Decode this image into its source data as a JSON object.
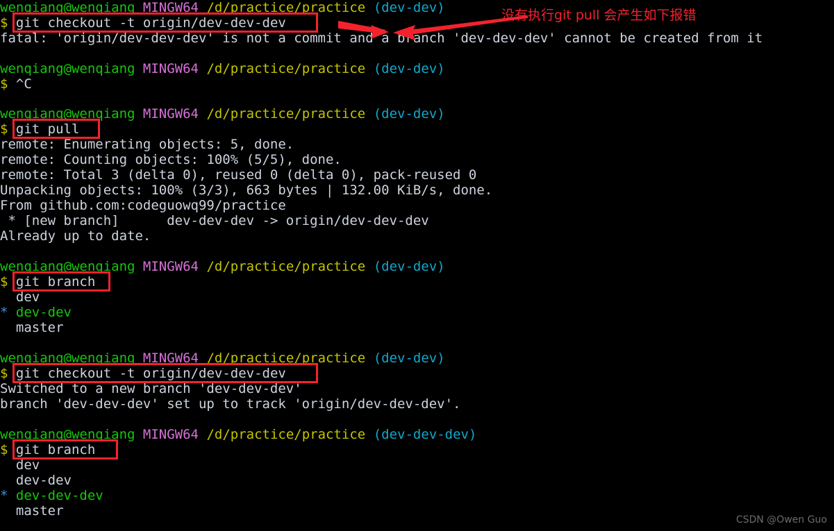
{
  "terminal": {
    "shell": "MINGW64",
    "user_host": "wenqiang@wenqiang",
    "path": "/d/practice/practice",
    "prompt_symbol": "$",
    "background_color": "#000000",
    "colors": {
      "user": "#16c60c",
      "mingw": "#d670d6",
      "path": "#c5c500",
      "branch": "#11a8cd",
      "prompt": "#c5c500",
      "output": "#cdd3de",
      "current_branch": "#16c60c",
      "star": "#3b8eea",
      "annotation": "#f5222d"
    }
  },
  "lines": {
    "l0_prompt_user": "wenqiang@wenqiang",
    "l0_prompt_mingw": "MINGW64",
    "l0_prompt_path": "/d/practice/practice",
    "l0_prompt_branch": "(dev-dev)",
    "l1_cmd_prompt": "$",
    "l1_cmd_text": "git checkout -t origin/dev-dev-dev",
    "l2_out": "fatal: 'origin/dev-dev-dev' is not a commit and a branch 'dev-dev-dev' cannot be created from it",
    "l4_prompt_branch": "(dev-dev)",
    "l5_cmd_prompt": "$",
    "l5_cmd_text": "^C",
    "l7_prompt_branch": "(dev-dev)",
    "l8_cmd_prompt": "$",
    "l8_cmd_text": "git pull",
    "l9_out": "remote: Enumerating objects: 5, done.",
    "l10_out": "remote: Counting objects: 100% (5/5), done.",
    "l11_out": "remote: Total 3 (delta 0), reused 0 (delta 0), pack-reused 0",
    "l12_out": "Unpacking objects: 100% (3/3), 663 bytes | 132.00 KiB/s, done.",
    "l13_out": "From github.com:codeguowq99/practice",
    "l14_out": " * [new branch]      dev-dev-dev -> origin/dev-dev-dev",
    "l15_out": "Already up to date.",
    "l17_prompt_branch": "(dev-dev)",
    "l18_cmd_prompt": "$",
    "l18_cmd_text": "git branch",
    "l19_out": "  dev",
    "l20_star": "*",
    "l20_branch": "dev-dev",
    "l21_out": "  master",
    "l23_prompt_branch": "(dev-dev)",
    "l24_cmd_prompt": "$",
    "l24_cmd_text": "git checkout -t origin/dev-dev-dev",
    "l25_out": "Switched to a new branch 'dev-dev-dev'",
    "l26_out": "branch 'dev-dev-dev' set up to track 'origin/dev-dev-dev'.",
    "l28_prompt_branch": "(dev-dev-dev)",
    "l29_cmd_prompt": "$",
    "l29_cmd_text": "git branch",
    "l30_out": "  dev",
    "l31_out": "  dev-dev",
    "l32_star": "*",
    "l32_branch": "dev-dev-dev",
    "l33_out": "  master"
  },
  "annotations": {
    "note_text": "没有执行git pull 会产生如下报错",
    "note_color": "#f5222d",
    "highlight_boxes": [
      "git checkout -t origin/dev-dev-dev",
      "git pull",
      "git branch",
      "git checkout -t origin/dev-dev-dev",
      "git branch"
    ]
  },
  "watermark": {
    "text": "CSDN @Owen Guo"
  }
}
